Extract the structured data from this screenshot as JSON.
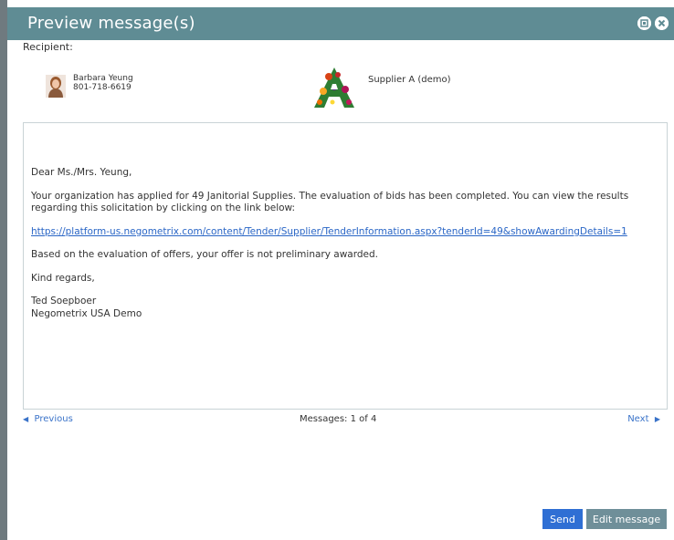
{
  "window": {
    "title": "Preview message(s)"
  },
  "recipient": {
    "label": "Recipient:",
    "name": "Barbara Yeung",
    "phone": "801-718-6619",
    "supplier": "Supplier A (demo)"
  },
  "message": {
    "greeting": "Dear Ms./Mrs. Yeung,",
    "body_line1": "Your organization has applied for 49 Janitorial Supplies. The evaluation of bids has been completed. You can view the results regarding this solicitation by clicking on the link below:",
    "link": "https://platform-us.negometrix.com/content/Tender/Supplier/TenderInformation.aspx?tenderId=49&showAwardingDetails=1",
    "body_line2": "Based on the evaluation of offers, your offer is not preliminary awarded.",
    "closing": "Kind regards,",
    "sender_name": "Ted Soepboer",
    "sender_org": "Negometrix USA Demo"
  },
  "pager": {
    "previous": "Previous",
    "count": "Messages: 1 of 4",
    "next": "Next"
  },
  "buttons": {
    "send": "Send",
    "edit": "Edit message"
  },
  "colors": {
    "titlebar": "#5f8c94",
    "link": "#2a66c6",
    "send": "#2f6fd4",
    "edit": "#6f8f99"
  },
  "icons": {
    "titlebar_left": "maximize-icon",
    "titlebar_right": "close-icon",
    "pager_prev": "triangle-left-icon",
    "pager_next": "triangle-right-icon"
  }
}
